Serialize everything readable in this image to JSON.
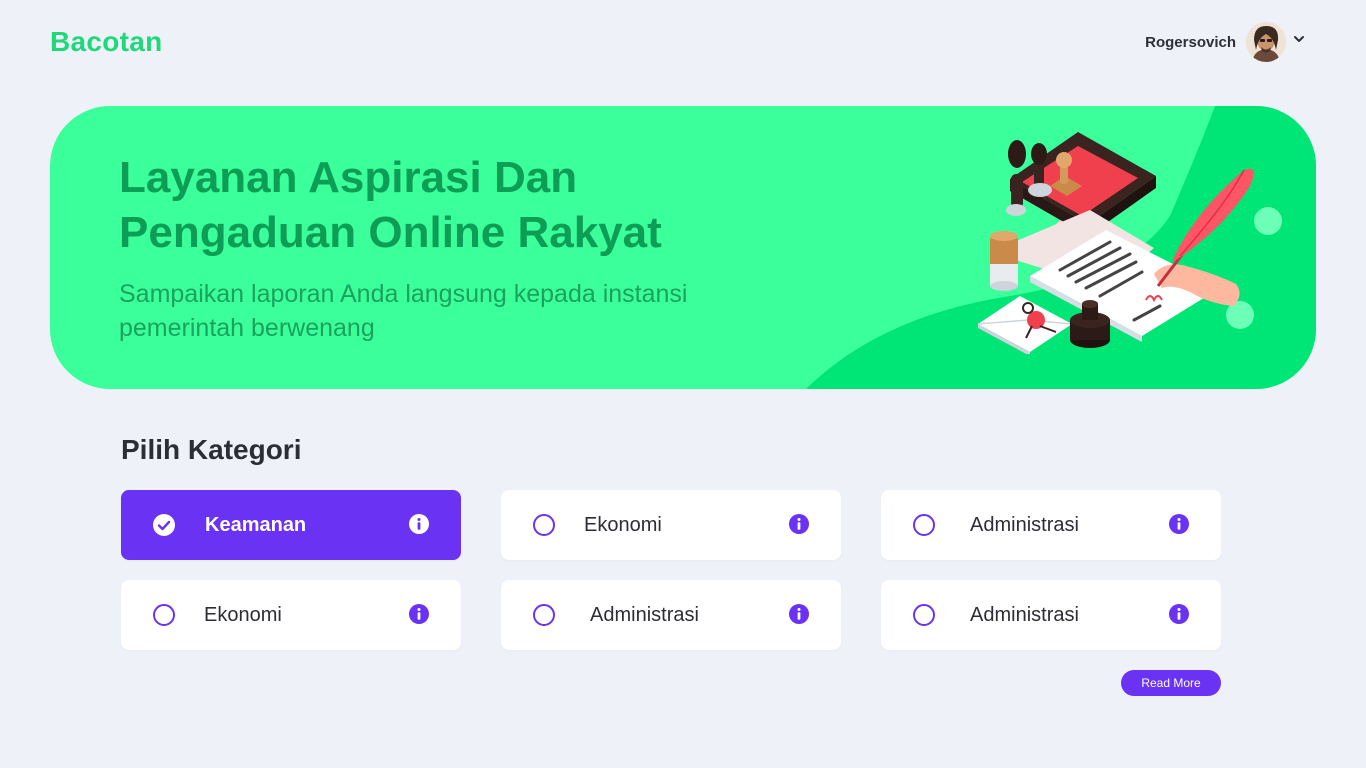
{
  "app": {
    "logo": "Bacotan"
  },
  "user": {
    "name": "Rogersovich",
    "avatar_icon": "user-avatar",
    "menu_icon": "chevron-down-icon"
  },
  "hero": {
    "title_line1": "Layanan Aspirasi Dan",
    "title_line2": "Pengaduan Online Rakyat",
    "subtitle": "Sampaikan laporan Anda langsung kepada instansi pemerintah berwenang",
    "illustration": "documents-stamps-quill-illustration"
  },
  "categories": {
    "title": "Pilih Kategori",
    "items": [
      {
        "label": "Keamanan",
        "selected": true
      },
      {
        "label": "Ekonomi",
        "selected": false
      },
      {
        "label": "Administrasi",
        "selected": false
      },
      {
        "label": "Ekonomi",
        "selected": false
      },
      {
        "label": "Administrasi",
        "selected": false
      },
      {
        "label": "Administrasi",
        "selected": false
      }
    ]
  },
  "actions": {
    "read_more": "Read More"
  },
  "colors": {
    "brand": "#1fd87a",
    "hero_bg": "#3bff9b",
    "hero_wave": "#00e676",
    "accent": "#6a32f2",
    "page_bg": "#eef2f8"
  }
}
